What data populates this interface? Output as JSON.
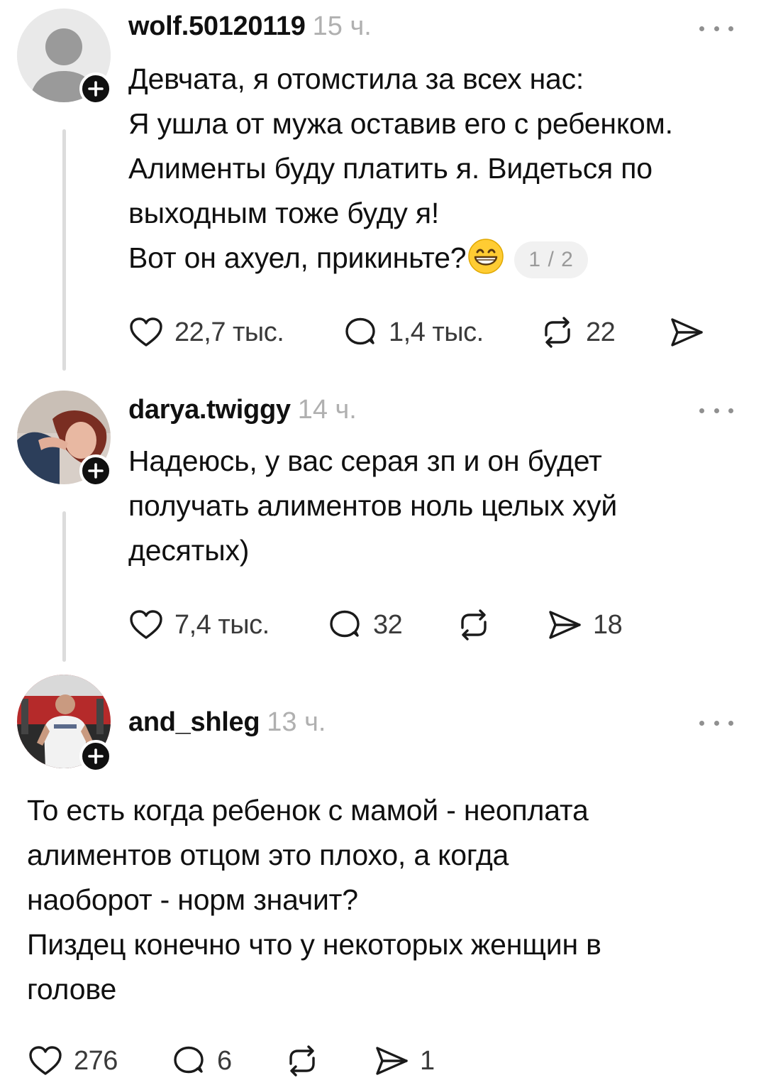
{
  "posts": [
    {
      "username": "wolf.50120119",
      "time": "15 ч.",
      "avatar": "default-avatar",
      "lines": [
        "Девчата, я отомстила за всех нас:",
        "Я ушла от мужа оставив его с ребенком.",
        "Алименты буду платить я. Видеться по",
        "выходным тоже буду я!",
        "Вот он ахуел, прикиньте?"
      ],
      "emoji": "grinning-face-emoji",
      "pager": "1 / 2",
      "likes": "22,7 тыс.",
      "replies": "1,4 тыс.",
      "reposts": "22",
      "shares": ""
    },
    {
      "username": "darya.twiggy",
      "time": "14 ч.",
      "avatar": "photo-avatar",
      "lines": [
        "Надеюсь, у вас серая зп и он будет",
        "получать алиментов ноль целых хуй",
        "десятых)"
      ],
      "likes": "7,4 тыс.",
      "replies": "32",
      "reposts": "",
      "shares": "18"
    },
    {
      "username": "and_shleg",
      "time": "13 ч.",
      "avatar": "photo-avatar",
      "lines": [
        "То есть когда ребенок с мамой - неоплата",
        "алиментов отцом это плохо, а когда",
        "наоборот - норм значит?",
        "Пиздец конечно что у некоторых женщин в",
        "голове"
      ],
      "likes": "276",
      "replies": "6",
      "reposts": "",
      "shares": "1"
    }
  ],
  "colors": {
    "text": "#101010",
    "muted": "#b0b0b0",
    "counts": "#3a3a3a",
    "thread_line": "#dcdcdc",
    "pager_bg": "#f1f1f1"
  }
}
